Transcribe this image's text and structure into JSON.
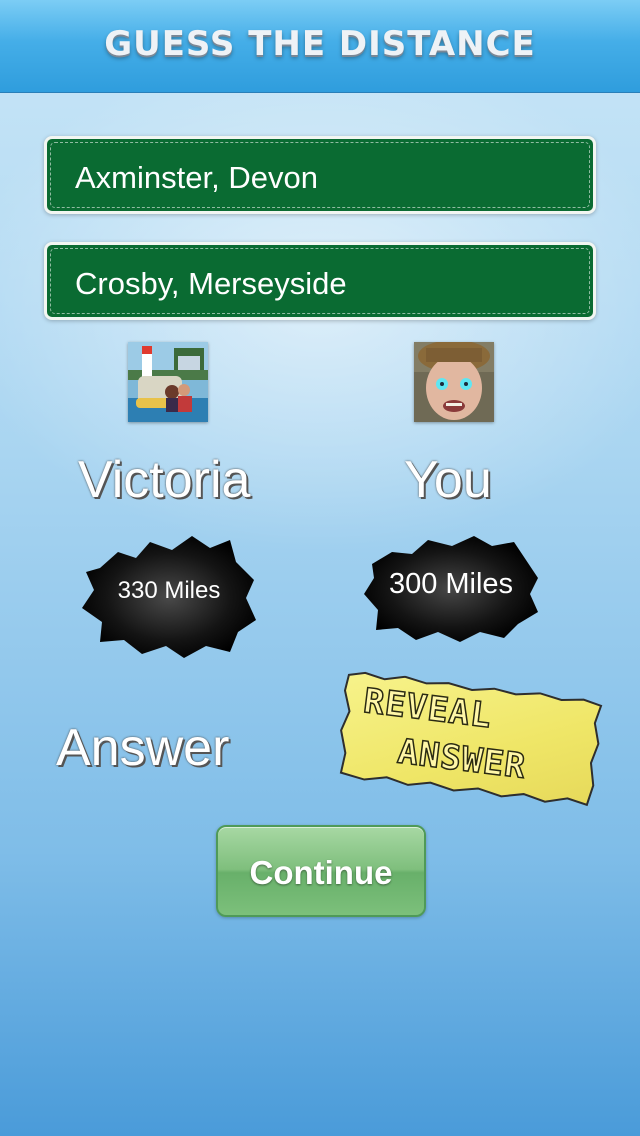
{
  "header": {
    "title": "GUESS THE DISTANCE"
  },
  "locations": [
    {
      "label": "Axminster, Devon"
    },
    {
      "label": "Crosby, Merseyside"
    }
  ],
  "players": [
    {
      "name": "Victoria",
      "guess": "330 Miles",
      "avatar_icon": "boat-photo"
    },
    {
      "name": "You",
      "guess": "300 Miles",
      "avatar_icon": "face-photo"
    }
  ],
  "answer": {
    "label": "Answer",
    "value": ""
  },
  "reveal": {
    "line1": "REVEAL",
    "line2": "ANSWER"
  },
  "continue_button": {
    "label": "Continue"
  },
  "colors": {
    "header": "#3aa7e4",
    "location_bg": "#0a6b32",
    "blob": "#111111",
    "sticker": "#f5f07a",
    "continue_bg": "#7fbf7d"
  }
}
